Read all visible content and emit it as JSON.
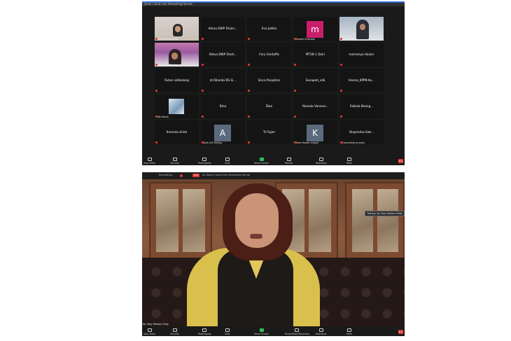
{
  "gallery": {
    "title": "Zoom Cloud Live Streaming Server",
    "tiles": [
      {
        "name": "",
        "caption": "KMPN Ulinggalang",
        "kind": "video-a"
      },
      {
        "name": "Ketua DWP Dirjen...",
        "caption": "",
        "kind": "text"
      },
      {
        "name": "Eva Jodika",
        "caption": "",
        "kind": "text"
      },
      {
        "name": "",
        "caption": "Haolah Sulandiar",
        "kind": "avatar",
        "letter": "m",
        "color": "#c81f6b"
      },
      {
        "name": "",
        "caption": "UIT DPHBKI",
        "kind": "video-c"
      },
      {
        "name": "",
        "caption": "Ketua TP. PKK Kab...",
        "kind": "video-b"
      },
      {
        "name": "Ketua DWP Disdi...",
        "caption": "",
        "kind": "text"
      },
      {
        "name": "Fery Gentaffa",
        "caption": "",
        "kind": "text"
      },
      {
        "name": "MTSN 1 Dairi",
        "caption": "",
        "kind": "text"
      },
      {
        "name": "mamanya Hauler",
        "caption": "",
        "kind": "text"
      },
      {
        "name": "Rutan sidikalang",
        "caption": "",
        "kind": "text"
      },
      {
        "name": "dr.Rikardo-RS Si...",
        "caption": "",
        "kind": "text"
      },
      {
        "name": "Sisca Panjaitan",
        "caption": "",
        "kind": "text"
      },
      {
        "name": "Sevapeti_sdk",
        "caption": "",
        "kind": "text"
      },
      {
        "name": "Hanna_KPPN Ko...",
        "caption": "",
        "kind": "text"
      },
      {
        "name": "",
        "caption": "Tati Nania",
        "kind": "video-d"
      },
      {
        "name": "Bina",
        "caption": "",
        "kind": "text"
      },
      {
        "name": "Dian",
        "caption": "",
        "kind": "text"
      },
      {
        "name": "Yolanda Varenss...",
        "caption": "",
        "kind": "text"
      },
      {
        "name": "Febiola Boang...",
        "caption": "",
        "kind": "text"
      },
      {
        "name": "theresia sihite",
        "caption": "",
        "kind": "text"
      },
      {
        "name": "",
        "caption": "Andi Arif Setting",
        "kind": "avatar",
        "letter": "A",
        "color": "#5b6b7d"
      },
      {
        "name": "Tri Fajari",
        "caption": "",
        "kind": "text"
      },
      {
        "name": "",
        "caption": "Kesti Rosida singkat",
        "kind": "avatar",
        "letter": "K",
        "color": "#5b6b7d"
      },
      {
        "name": "Dispendas Kab...",
        "caption": "Connecting to audio",
        "kind": "text"
      }
    ],
    "toolbar": [
      {
        "label": "Stop Video",
        "icon": "video-icon"
      },
      {
        "label": "Security",
        "icon": "shield-icon"
      },
      {
        "label": "Participants",
        "icon": "participants-icon"
      },
      {
        "label": "Chat",
        "icon": "chat-icon"
      },
      {
        "label": "Share Screen",
        "icon": "share-screen-icon",
        "green": true
      },
      {
        "label": "Record",
        "icon": "record-icon"
      },
      {
        "label": "Reactions",
        "icon": "reactions-icon"
      },
      {
        "label": "More",
        "icon": "more-icon"
      }
    ],
    "end": "End"
  },
  "speaker": {
    "top_title": "Recording...",
    "live": "LIVE",
    "stream_title": "on Zoom Cloud Live Streaming Server",
    "talking": "Talking: Ny. Koty Mariani Eddy",
    "own_name": "Ny. Koty Mariani Eddy",
    "toolbar": [
      {
        "label": "Stop Video",
        "icon": "video-icon"
      },
      {
        "label": "Security",
        "icon": "shield-icon"
      },
      {
        "label": "Participants",
        "icon": "participants-icon"
      },
      {
        "label": "Chat",
        "icon": "chat-icon"
      },
      {
        "label": "Share Screen",
        "icon": "share-screen-icon",
        "green": true
      },
      {
        "label": "Pause/Stop Recording",
        "icon": "record-icon"
      },
      {
        "label": "Reactions",
        "icon": "reactions-icon"
      },
      {
        "label": "More",
        "icon": "more-icon"
      }
    ],
    "end": "End"
  }
}
